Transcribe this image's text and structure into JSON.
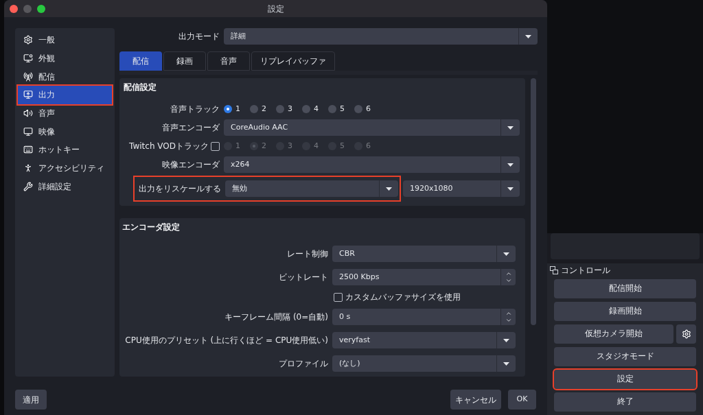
{
  "window": {
    "title": "設定"
  },
  "sidebar": {
    "items": [
      {
        "label": "一般",
        "selected": false,
        "highlighted": false
      },
      {
        "label": "外観",
        "selected": false,
        "highlighted": false
      },
      {
        "label": "配信",
        "selected": false,
        "highlighted": false
      },
      {
        "label": "出力",
        "selected": true,
        "highlighted": true
      },
      {
        "label": "音声",
        "selected": false,
        "highlighted": false
      },
      {
        "label": "映像",
        "selected": false,
        "highlighted": false
      },
      {
        "label": "ホットキー",
        "selected": false,
        "highlighted": false
      },
      {
        "label": "アクセシビリティ",
        "selected": false,
        "highlighted": false
      },
      {
        "label": "詳細設定",
        "selected": false,
        "highlighted": false
      }
    ]
  },
  "output_mode": {
    "label": "出力モード",
    "value": "詳細"
  },
  "tabs": [
    {
      "label": "配信",
      "selected": true
    },
    {
      "label": "録画",
      "selected": false
    },
    {
      "label": "音声",
      "selected": false
    },
    {
      "label": "リプレイバッファ",
      "selected": false
    }
  ],
  "stream_section": {
    "title": "配信設定",
    "rows": [
      {
        "kind": "radio",
        "label": "音声トラック",
        "disabled": false,
        "options": [
          {
            "label": "1",
            "selected": true
          },
          {
            "label": "2",
            "selected": false
          },
          {
            "label": "3",
            "selected": false
          },
          {
            "label": "4",
            "selected": false
          },
          {
            "label": "5",
            "selected": false
          },
          {
            "label": "6",
            "selected": false
          }
        ]
      },
      {
        "kind": "select",
        "label": "音声エンコーダ",
        "value": "CoreAudio AAC"
      },
      {
        "kind": "radio",
        "label": "Twitch VODトラック",
        "checkbox": {
          "checked": false
        },
        "disabled": true,
        "options": [
          {
            "label": "1",
            "selected": false
          },
          {
            "label": "2",
            "selected": true
          },
          {
            "label": "3",
            "selected": false
          },
          {
            "label": "4",
            "selected": false
          },
          {
            "label": "5",
            "selected": false
          },
          {
            "label": "6",
            "selected": false
          }
        ]
      },
      {
        "kind": "select",
        "label": "映像エンコーダ",
        "value": "x264"
      },
      {
        "kind": "rescale",
        "label": "出力をリスケールする",
        "value": "無効",
        "resolution": "1920x1080",
        "highlighted": true
      }
    ]
  },
  "encoder_section": {
    "title": "エンコーダ設定",
    "rows": [
      {
        "kind": "select",
        "label": "レート制御",
        "value": "CBR"
      },
      {
        "kind": "spin",
        "label": "ビットレート",
        "value": "2500 Kbps"
      },
      {
        "kind": "checkbox",
        "label": "カスタムバッファサイズを使用",
        "checked": false
      },
      {
        "kind": "spin",
        "label": "キーフレーム間隔 (0=自動)",
        "value": "0 s"
      },
      {
        "kind": "select",
        "label": "CPU使用のプリセット (上に行くほど = CPU使用低い)",
        "value": "veryfast"
      },
      {
        "kind": "select",
        "label": "プロファイル",
        "value": "(なし)"
      }
    ]
  },
  "footer": {
    "apply": "適用",
    "cancel": "キャンセル",
    "ok": "OK"
  },
  "controls_dock": {
    "title": "コントロール",
    "buttons": [
      {
        "kind": "plain",
        "label": "配信開始",
        "highlighted": false
      },
      {
        "kind": "plain",
        "label": "録画開始",
        "highlighted": false
      },
      {
        "kind": "with_gear",
        "label": "仮想カメラ開始",
        "highlighted": false
      },
      {
        "kind": "plain",
        "label": "スタジオモード",
        "highlighted": false
      },
      {
        "kind": "plain",
        "label": "設定",
        "highlighted": true
      },
      {
        "kind": "plain",
        "label": "終了",
        "highlighted": false
      }
    ]
  }
}
